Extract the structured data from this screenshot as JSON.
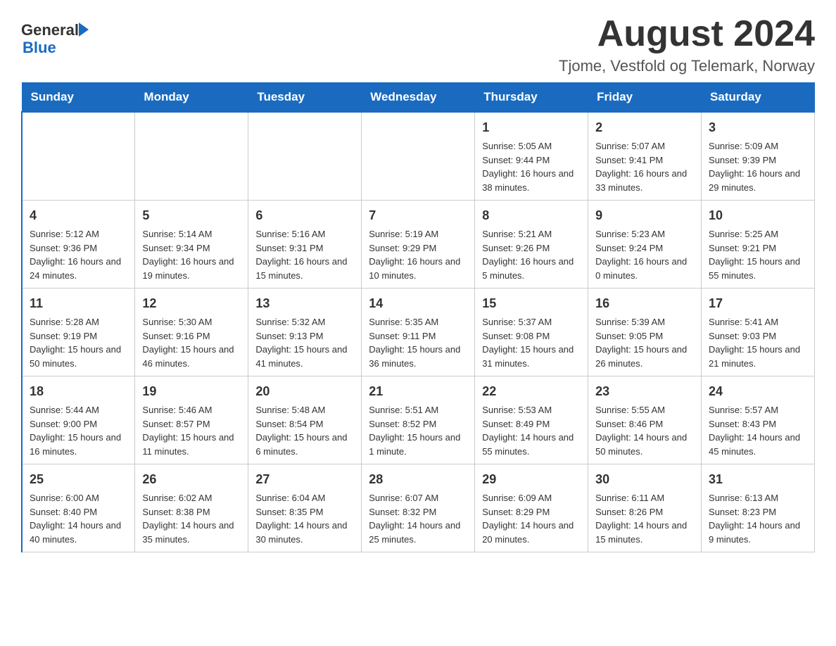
{
  "header": {
    "month_title": "August 2024",
    "location": "Tjome, Vestfold og Telemark, Norway",
    "logo_general": "General",
    "logo_blue": "Blue"
  },
  "days_of_week": [
    "Sunday",
    "Monday",
    "Tuesday",
    "Wednesday",
    "Thursday",
    "Friday",
    "Saturday"
  ],
  "weeks": [
    [
      {
        "day": "",
        "info": ""
      },
      {
        "day": "",
        "info": ""
      },
      {
        "day": "",
        "info": ""
      },
      {
        "day": "",
        "info": ""
      },
      {
        "day": "1",
        "info": "Sunrise: 5:05 AM\nSunset: 9:44 PM\nDaylight: 16 hours and 38 minutes."
      },
      {
        "day": "2",
        "info": "Sunrise: 5:07 AM\nSunset: 9:41 PM\nDaylight: 16 hours and 33 minutes."
      },
      {
        "day": "3",
        "info": "Sunrise: 5:09 AM\nSunset: 9:39 PM\nDaylight: 16 hours and 29 minutes."
      }
    ],
    [
      {
        "day": "4",
        "info": "Sunrise: 5:12 AM\nSunset: 9:36 PM\nDaylight: 16 hours and 24 minutes."
      },
      {
        "day": "5",
        "info": "Sunrise: 5:14 AM\nSunset: 9:34 PM\nDaylight: 16 hours and 19 minutes."
      },
      {
        "day": "6",
        "info": "Sunrise: 5:16 AM\nSunset: 9:31 PM\nDaylight: 16 hours and 15 minutes."
      },
      {
        "day": "7",
        "info": "Sunrise: 5:19 AM\nSunset: 9:29 PM\nDaylight: 16 hours and 10 minutes."
      },
      {
        "day": "8",
        "info": "Sunrise: 5:21 AM\nSunset: 9:26 PM\nDaylight: 16 hours and 5 minutes."
      },
      {
        "day": "9",
        "info": "Sunrise: 5:23 AM\nSunset: 9:24 PM\nDaylight: 16 hours and 0 minutes."
      },
      {
        "day": "10",
        "info": "Sunrise: 5:25 AM\nSunset: 9:21 PM\nDaylight: 15 hours and 55 minutes."
      }
    ],
    [
      {
        "day": "11",
        "info": "Sunrise: 5:28 AM\nSunset: 9:19 PM\nDaylight: 15 hours and 50 minutes."
      },
      {
        "day": "12",
        "info": "Sunrise: 5:30 AM\nSunset: 9:16 PM\nDaylight: 15 hours and 46 minutes."
      },
      {
        "day": "13",
        "info": "Sunrise: 5:32 AM\nSunset: 9:13 PM\nDaylight: 15 hours and 41 minutes."
      },
      {
        "day": "14",
        "info": "Sunrise: 5:35 AM\nSunset: 9:11 PM\nDaylight: 15 hours and 36 minutes."
      },
      {
        "day": "15",
        "info": "Sunrise: 5:37 AM\nSunset: 9:08 PM\nDaylight: 15 hours and 31 minutes."
      },
      {
        "day": "16",
        "info": "Sunrise: 5:39 AM\nSunset: 9:05 PM\nDaylight: 15 hours and 26 minutes."
      },
      {
        "day": "17",
        "info": "Sunrise: 5:41 AM\nSunset: 9:03 PM\nDaylight: 15 hours and 21 minutes."
      }
    ],
    [
      {
        "day": "18",
        "info": "Sunrise: 5:44 AM\nSunset: 9:00 PM\nDaylight: 15 hours and 16 minutes."
      },
      {
        "day": "19",
        "info": "Sunrise: 5:46 AM\nSunset: 8:57 PM\nDaylight: 15 hours and 11 minutes."
      },
      {
        "day": "20",
        "info": "Sunrise: 5:48 AM\nSunset: 8:54 PM\nDaylight: 15 hours and 6 minutes."
      },
      {
        "day": "21",
        "info": "Sunrise: 5:51 AM\nSunset: 8:52 PM\nDaylight: 15 hours and 1 minute."
      },
      {
        "day": "22",
        "info": "Sunrise: 5:53 AM\nSunset: 8:49 PM\nDaylight: 14 hours and 55 minutes."
      },
      {
        "day": "23",
        "info": "Sunrise: 5:55 AM\nSunset: 8:46 PM\nDaylight: 14 hours and 50 minutes."
      },
      {
        "day": "24",
        "info": "Sunrise: 5:57 AM\nSunset: 8:43 PM\nDaylight: 14 hours and 45 minutes."
      }
    ],
    [
      {
        "day": "25",
        "info": "Sunrise: 6:00 AM\nSunset: 8:40 PM\nDaylight: 14 hours and 40 minutes."
      },
      {
        "day": "26",
        "info": "Sunrise: 6:02 AM\nSunset: 8:38 PM\nDaylight: 14 hours and 35 minutes."
      },
      {
        "day": "27",
        "info": "Sunrise: 6:04 AM\nSunset: 8:35 PM\nDaylight: 14 hours and 30 minutes."
      },
      {
        "day": "28",
        "info": "Sunrise: 6:07 AM\nSunset: 8:32 PM\nDaylight: 14 hours and 25 minutes."
      },
      {
        "day": "29",
        "info": "Sunrise: 6:09 AM\nSunset: 8:29 PM\nDaylight: 14 hours and 20 minutes."
      },
      {
        "day": "30",
        "info": "Sunrise: 6:11 AM\nSunset: 8:26 PM\nDaylight: 14 hours and 15 minutes."
      },
      {
        "day": "31",
        "info": "Sunrise: 6:13 AM\nSunset: 8:23 PM\nDaylight: 14 hours and 9 minutes."
      }
    ]
  ]
}
